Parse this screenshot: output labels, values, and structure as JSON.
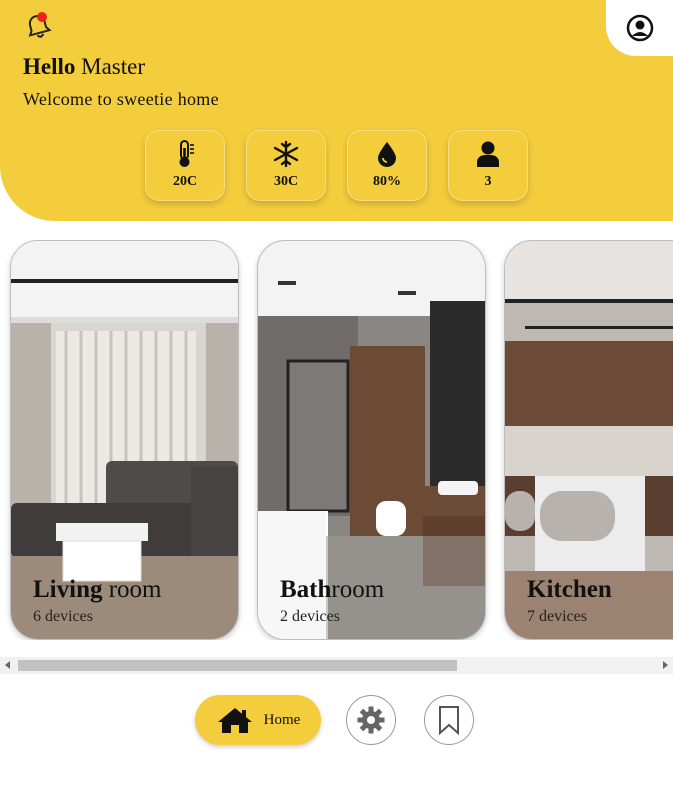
{
  "header": {
    "greeting_bold": "Hello",
    "greeting_rest": " Master",
    "welcome": "Welcome to sweetie home",
    "icons": {
      "notification": "bell-icon",
      "profile": "user-circle-icon"
    },
    "accent_color": "#f4cd3c",
    "notification_dot_color": "#e8231a"
  },
  "stats": [
    {
      "icon": "thermometer-icon",
      "value": "20C"
    },
    {
      "icon": "snowflake-icon",
      "value": "30C"
    },
    {
      "icon": "water-drop-icon",
      "value": "80%"
    },
    {
      "icon": "person-icon",
      "value": "3"
    }
  ],
  "rooms": [
    {
      "name_bold": "Living",
      "name_rest": " room",
      "devices": "6 devices"
    },
    {
      "name_bold": "Bath",
      "name_rest": "room",
      "devices": "2 devices"
    },
    {
      "name_bold": "Kitchen",
      "name_rest": "",
      "devices": "7 devices"
    }
  ],
  "nav": {
    "home_label": "Home",
    "icons": [
      "home-icon",
      "gear-icon",
      "bookmark-icon"
    ]
  }
}
